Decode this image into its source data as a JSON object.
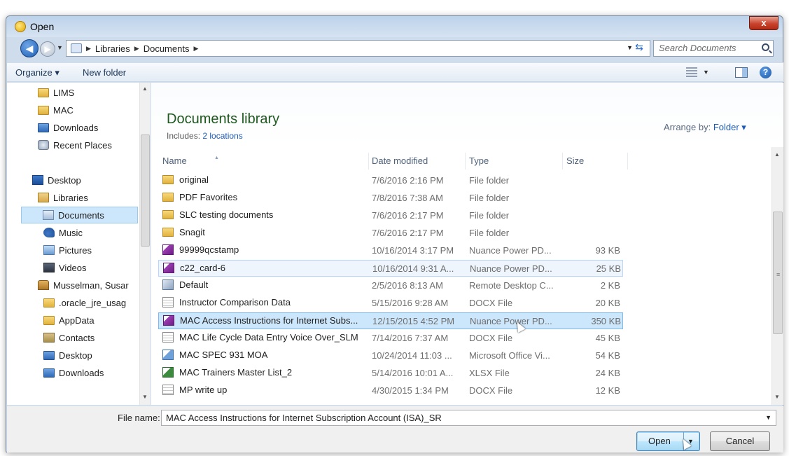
{
  "window": {
    "title": "Open",
    "close_label": "x"
  },
  "address": {
    "crumbs": [
      "Libraries",
      "Documents"
    ],
    "search_placeholder": "Search Documents"
  },
  "toolbar": {
    "organize_label": "Organize ▾",
    "new_folder_label": "New folder"
  },
  "sidebar": {
    "items": [
      {
        "label": "LIMS",
        "icon": "folder-icon"
      },
      {
        "label": "MAC",
        "icon": "folder-icon"
      },
      {
        "label": "Downloads",
        "icon": "downloads-icon"
      },
      {
        "label": "Recent Places",
        "icon": "recent-places-icon"
      },
      {
        "label": "Desktop",
        "icon": "desktop-icon"
      },
      {
        "label": "Libraries",
        "icon": "libraries-icon"
      },
      {
        "label": "Documents",
        "icon": "documents-icon"
      },
      {
        "label": "Music",
        "icon": "music-icon"
      },
      {
        "label": "Pictures",
        "icon": "pictures-icon"
      },
      {
        "label": "Videos",
        "icon": "videos-icon"
      },
      {
        "label": "Musselman, Susar",
        "icon": "user-folder-icon"
      },
      {
        "label": ".oracle_jre_usag",
        "icon": "folder-icon"
      },
      {
        "label": "AppData",
        "icon": "folder-icon"
      },
      {
        "label": "Contacts",
        "icon": "contacts-icon"
      },
      {
        "label": "Desktop",
        "icon": "desktop-folder-icon"
      },
      {
        "label": "Downloads",
        "icon": "downloads-icon"
      }
    ]
  },
  "library": {
    "title": "Documents library",
    "includes_prefix": "Includes: ",
    "includes_link": "2 locations",
    "arrange_label": "Arrange by:",
    "arrange_value": "Folder ▾"
  },
  "columns": {
    "name": "Name",
    "date": "Date modified",
    "type": "Type",
    "size": "Size"
  },
  "files": [
    {
      "name": "original",
      "date": "7/6/2016 2:16 PM",
      "type": "File folder",
      "size": "",
      "icon": "folder-icon"
    },
    {
      "name": "PDF Favorites",
      "date": "7/8/2016 7:38 AM",
      "type": "File folder",
      "size": "",
      "icon": "folder-icon"
    },
    {
      "name": "SLC testing documents",
      "date": "7/6/2016 2:17 PM",
      "type": "File folder",
      "size": "",
      "icon": "folder-icon"
    },
    {
      "name": "Snagit",
      "date": "7/6/2016 2:17 PM",
      "type": "File folder",
      "size": "",
      "icon": "folder-icon"
    },
    {
      "name": "99999qcstamp",
      "date": "10/16/2014 3:17 PM",
      "type": "Nuance Power PD...",
      "size": "93 KB",
      "icon": "pdf-icon"
    },
    {
      "name": "c22_card-6",
      "date": "10/16/2014 9:31 A...",
      "type": "Nuance Power PD...",
      "size": "25 KB",
      "icon": "pdf-icon"
    },
    {
      "name": "Default",
      "date": "2/5/2016 8:13 AM",
      "type": "Remote Desktop C...",
      "size": "2 KB",
      "icon": "remote-desktop-icon"
    },
    {
      "name": "Instructor Comparison Data",
      "date": "5/15/2016 9:28 AM",
      "type": "DOCX File",
      "size": "20 KB",
      "icon": "docx-icon"
    },
    {
      "name": "MAC Access Instructions for Internet Subs...",
      "date": "12/15/2015 4:52 PM",
      "type": "Nuance Power PD...",
      "size": "350 KB",
      "icon": "pdf-icon"
    },
    {
      "name": "MAC Life Cycle Data Entry Voice Over_SLM",
      "date": "7/14/2016 7:37 AM",
      "type": "DOCX File",
      "size": "45 KB",
      "icon": "docx-icon"
    },
    {
      "name": "MAC SPEC 931 MOA",
      "date": "10/24/2014 11:03 ...",
      "type": "Microsoft Office Vi...",
      "size": "54 KB",
      "icon": "visio-icon"
    },
    {
      "name": "MAC Trainers Master List_2",
      "date": "5/14/2016 10:01 A...",
      "type": "XLSX File",
      "size": "24 KB",
      "icon": "xlsx-icon"
    },
    {
      "name": "MP write up",
      "date": "4/30/2015 1:34 PM",
      "type": "DOCX File",
      "size": "12 KB",
      "icon": "docx-icon"
    }
  ],
  "footer": {
    "file_name_label": "File name:",
    "file_name_value": "MAC Access Instructions for Internet Subscription Account (ISA)_SR",
    "open_label": "Open",
    "cancel_label": "Cancel"
  }
}
